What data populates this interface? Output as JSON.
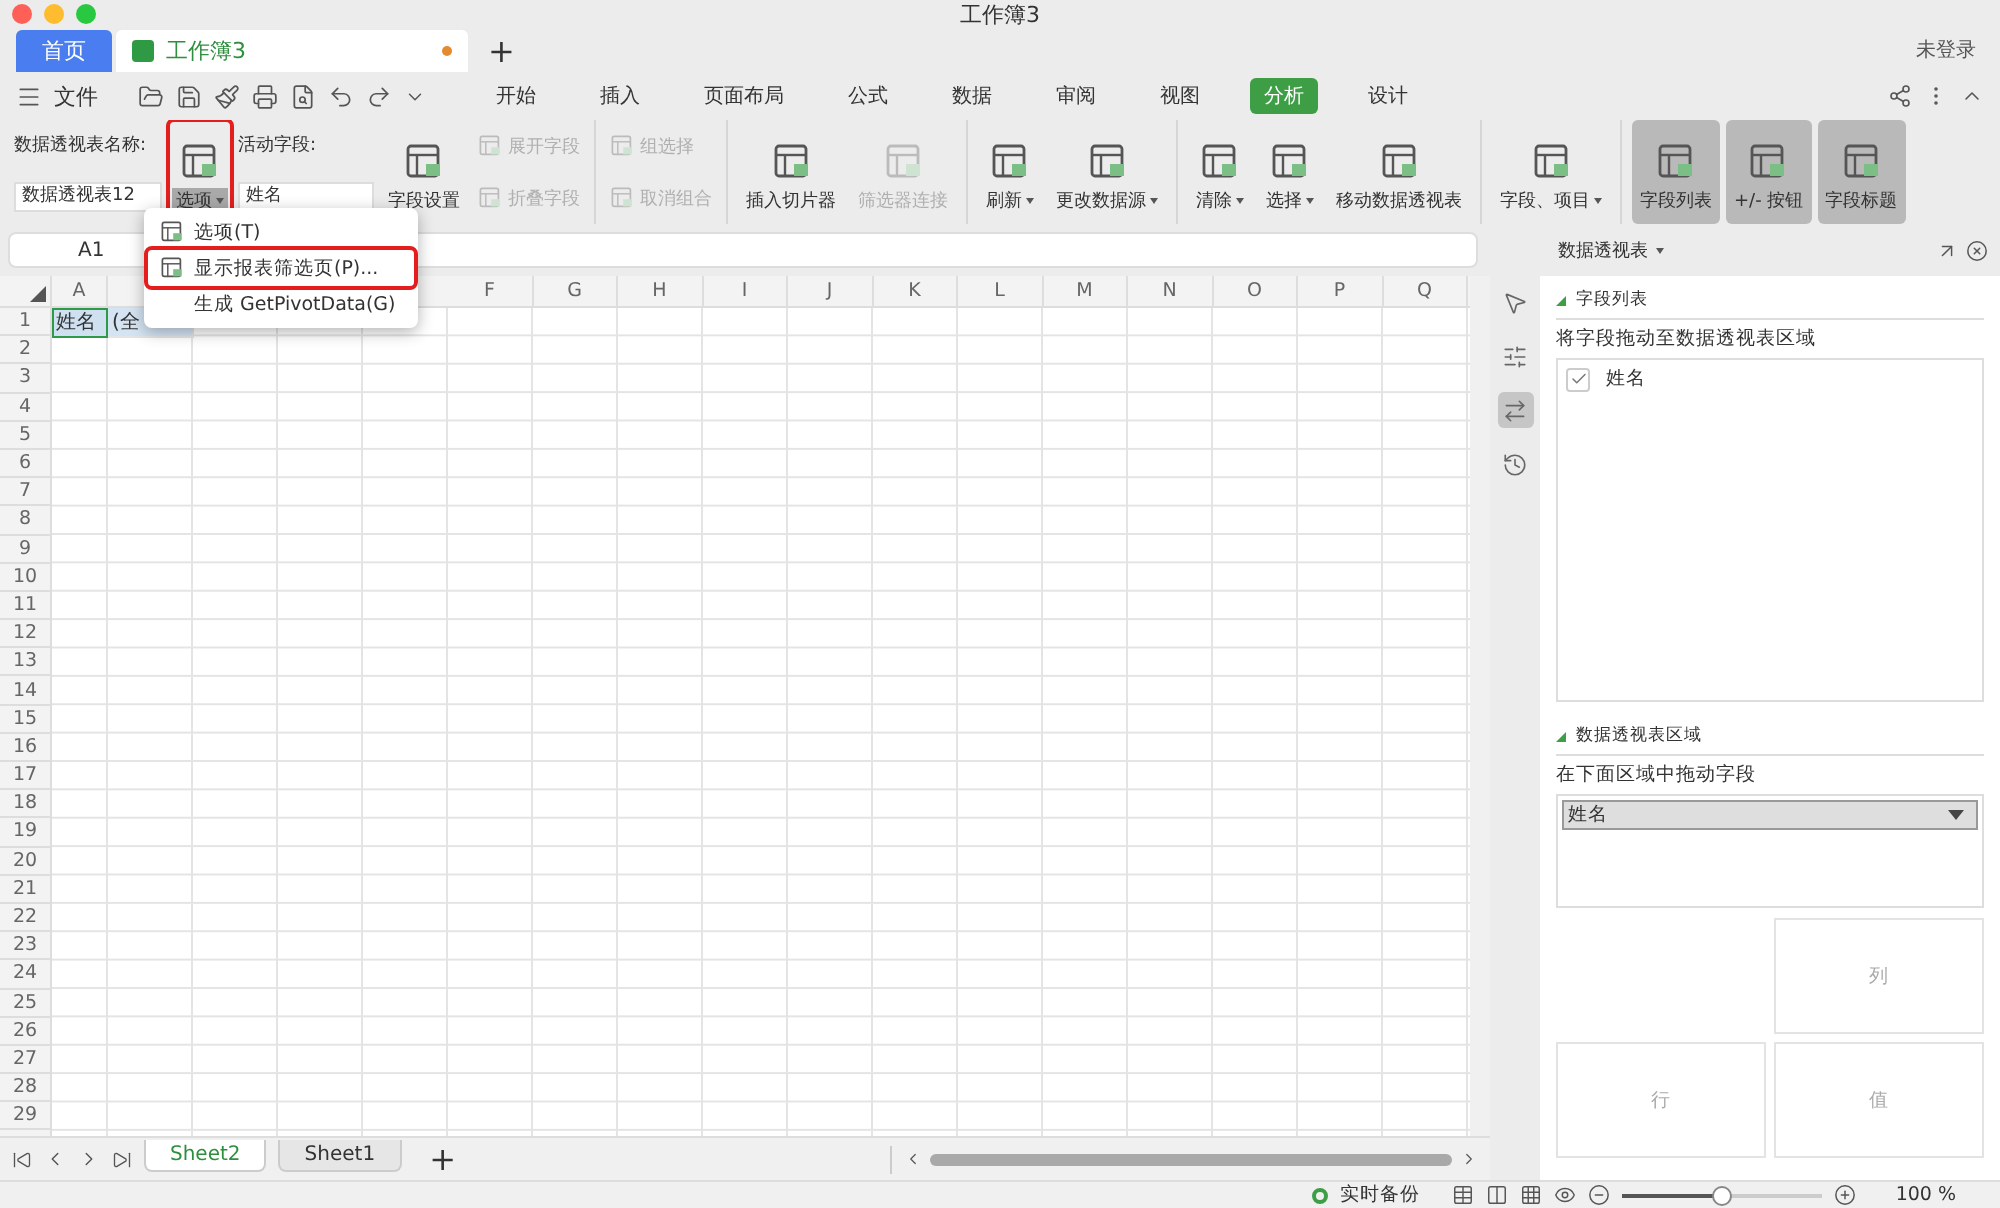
{
  "window": {
    "title": "工作簿3",
    "login": "未登录"
  },
  "tabs": [
    {
      "label": "首页",
      "kind": "home",
      "selected": false,
      "modified": false
    },
    {
      "label": "工作簿3",
      "kind": "doc",
      "selected": true,
      "modified": true
    }
  ],
  "tab_add": "+",
  "menu": {
    "file": "文件",
    "tabs": [
      {
        "label": "开始",
        "selected": false
      },
      {
        "label": "插入",
        "selected": false
      },
      {
        "label": "页面布局",
        "selected": false
      },
      {
        "label": "公式",
        "selected": false
      },
      {
        "label": "数据",
        "selected": false
      },
      {
        "label": "审阅",
        "selected": false
      },
      {
        "label": "视图",
        "selected": false
      },
      {
        "label": "分析",
        "selected": true
      },
      {
        "label": "设计",
        "selected": false
      }
    ]
  },
  "ribbon": {
    "pivot_name_label": "数据透视表名称:",
    "pivot_name": "数据透视表12",
    "options": {
      "label": "选项",
      "dropdown": true,
      "highlighted": true
    },
    "active_field_label": "活动字段:",
    "active_field": "姓名",
    "groups": [
      {
        "columns": [
          {
            "kind": "large",
            "label": "字段设置",
            "disabled": false,
            "dropdown": false,
            "pressed": false
          },
          {
            "kind": "stack",
            "items": [
              {
                "label": "展开字段",
                "disabled": true
              },
              {
                "label": "折叠字段",
                "disabled": true
              }
            ]
          }
        ]
      },
      {
        "columns": [
          {
            "kind": "stack",
            "items": [
              {
                "label": "组选择",
                "disabled": true
              },
              {
                "label": "取消组合",
                "disabled": true
              }
            ]
          }
        ]
      },
      {
        "columns": [
          {
            "kind": "large",
            "label": "插入切片器",
            "disabled": false,
            "dropdown": false,
            "pressed": false
          },
          {
            "kind": "large",
            "label": "筛选器连接",
            "disabled": true,
            "dropdown": false,
            "pressed": false
          }
        ]
      },
      {
        "columns": [
          {
            "kind": "large",
            "label": "刷新",
            "disabled": false,
            "dropdown": true,
            "pressed": false
          },
          {
            "kind": "large",
            "label": "更改数据源",
            "disabled": false,
            "dropdown": true,
            "pressed": false
          }
        ]
      },
      {
        "columns": [
          {
            "kind": "large",
            "label": "清除",
            "disabled": false,
            "dropdown": true,
            "pressed": false
          },
          {
            "kind": "large",
            "label": "选择",
            "disabled": false,
            "dropdown": true,
            "pressed": false
          },
          {
            "kind": "large",
            "label": "移动数据透视表",
            "disabled": false,
            "dropdown": false,
            "pressed": false
          }
        ]
      },
      {
        "columns": [
          {
            "kind": "large",
            "label": "字段、项目",
            "disabled": false,
            "dropdown": true,
            "pressed": false
          }
        ]
      },
      {
        "columns": [
          {
            "kind": "large",
            "label": "字段列表",
            "disabled": false,
            "dropdown": false,
            "pressed": true
          },
          {
            "kind": "large",
            "label": "+/- 按钮",
            "disabled": false,
            "dropdown": false,
            "pressed": true
          },
          {
            "kind": "large",
            "label": "字段标题",
            "disabled": false,
            "dropdown": false,
            "pressed": true
          }
        ]
      }
    ]
  },
  "options_menu": {
    "items": [
      {
        "label": "选项(T)",
        "icon": true,
        "highlighted": false
      },
      {
        "label": "显示报表筛选页(P)...",
        "icon": true,
        "highlighted": true
      },
      {
        "label": "生成 GetPivotData(G)",
        "icon": false,
        "highlighted": false
      }
    ]
  },
  "name_box": "A1",
  "grid": {
    "columns": [
      {
        "kind": "header",
        "label": "A"
      },
      {
        "kind": "covered"
      },
      {
        "kind": "covered"
      },
      {
        "kind": "covered"
      },
      {
        "kind": "covered"
      },
      {
        "kind": "header",
        "label": "F"
      },
      {
        "kind": "header",
        "label": "G"
      },
      {
        "kind": "header",
        "label": "H"
      },
      {
        "kind": "header",
        "label": "I"
      },
      {
        "kind": "header",
        "label": "J"
      },
      {
        "kind": "header",
        "label": "K"
      },
      {
        "kind": "header",
        "label": "L"
      },
      {
        "kind": "header",
        "label": "M"
      },
      {
        "kind": "header",
        "label": "N"
      },
      {
        "kind": "header",
        "label": "O"
      },
      {
        "kind": "header",
        "label": "P"
      },
      {
        "kind": "header",
        "label": "Q"
      }
    ],
    "rows": [
      {
        "label": "1",
        "cells": [
          {
            "text": "姓名",
            "selected": true
          },
          {
            "text": "(全",
            "selected": false
          }
        ]
      },
      {
        "label": "2"
      },
      {
        "label": "3"
      },
      {
        "label": "4"
      },
      {
        "label": "5"
      },
      {
        "label": "6"
      },
      {
        "label": "7"
      },
      {
        "label": "8"
      },
      {
        "label": "9"
      },
      {
        "label": "10"
      },
      {
        "label": "11"
      },
      {
        "label": "12"
      },
      {
        "label": "13"
      },
      {
        "label": "14"
      },
      {
        "label": "15"
      },
      {
        "label": "16"
      },
      {
        "label": "17"
      },
      {
        "label": "18"
      },
      {
        "label": "19"
      },
      {
        "label": "20"
      },
      {
        "label": "21"
      },
      {
        "label": "22"
      },
      {
        "label": "23"
      },
      {
        "label": "24"
      },
      {
        "label": "25"
      },
      {
        "label": "26"
      },
      {
        "label": "27"
      },
      {
        "label": "28"
      },
      {
        "label": "29"
      }
    ]
  },
  "side_tools": [
    {
      "kind": "pointer",
      "selected": false
    },
    {
      "kind": "sliders",
      "selected": false
    },
    {
      "kind": "pivot",
      "selected": true
    },
    {
      "kind": "history",
      "selected": false
    }
  ],
  "panel": {
    "title": "数据透视表",
    "field_section": "字段列表",
    "field_hint": "将字段拖动至数据透视表区域",
    "fields": [
      {
        "label": "姓名",
        "checked": true
      }
    ],
    "area_section": "数据透视表区域",
    "area_hint": "在下面区域中拖动字段",
    "filters": [
      "姓名"
    ],
    "column_area": "列",
    "row_area": "行",
    "value_area": "值"
  },
  "sheets": [
    {
      "label": "Sheet2",
      "selected": true
    },
    {
      "label": "Sheet1",
      "selected": false
    }
  ],
  "sheet_add": "+",
  "status": {
    "backup": "实时备份",
    "zoom": {
      "level": 0.5
    },
    "zoom_text": "100 %"
  }
}
